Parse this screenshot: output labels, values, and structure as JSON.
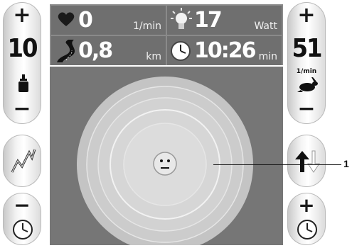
{
  "left": {
    "plus": "+",
    "minus": "−",
    "value": "10",
    "mode_icon": "weight-icon",
    "graph_icon": "graph-icon",
    "time_minus": "−",
    "clock_icon": "clock-icon"
  },
  "right": {
    "plus": "+",
    "minus": "−",
    "value": "51",
    "value_unit": "1/min",
    "mode_icon": "rabbit-icon",
    "arrows_icon": "up-down-arrows-icon",
    "time_plus": "+",
    "clock_icon": "clock-icon"
  },
  "stats": {
    "heart": {
      "value": "0",
      "unit": "1/min",
      "icon": "heart-icon"
    },
    "power": {
      "value": "17",
      "unit": "Watt",
      "icon": "bulb-icon"
    },
    "distance": {
      "value": "0,8",
      "unit": "km",
      "icon": "road-icon"
    },
    "time": {
      "value": "10:26",
      "unit": "min",
      "icon": "clock-icon"
    }
  },
  "center": {
    "icon": "neutral-face-icon"
  },
  "callout": {
    "label": "1"
  }
}
